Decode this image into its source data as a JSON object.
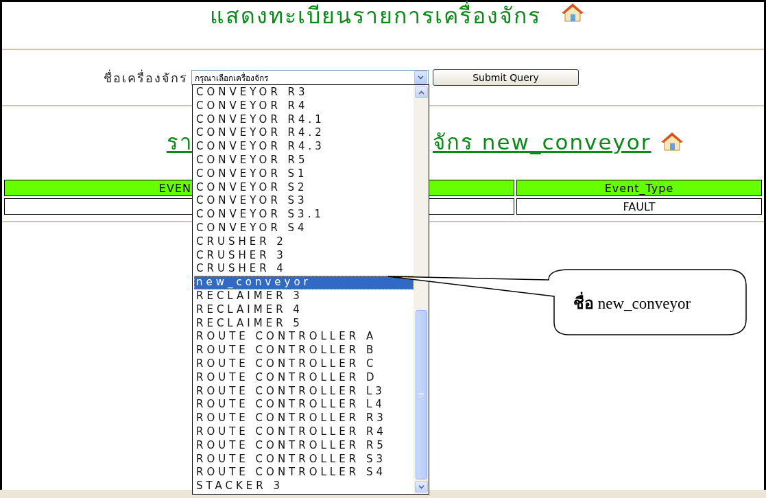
{
  "page_title": "แสดงทะเบียนรายการเครื่องจักร",
  "form": {
    "label": "ชื่อเครื่องจักร",
    "select": {
      "value": "กรุณาเลือกเครื่องจักร",
      "expanded": true
    },
    "submit": "Submit Query"
  },
  "dropdown": {
    "items": [
      {
        "label": "CONVEYOR R3",
        "selected": false
      },
      {
        "label": "CONVEYOR R4",
        "selected": false
      },
      {
        "label": "CONVEYOR R4.1",
        "selected": false
      },
      {
        "label": "CONVEYOR R4.2",
        "selected": false
      },
      {
        "label": "CONVEYOR R4.3",
        "selected": false
      },
      {
        "label": "CONVEYOR R5",
        "selected": false
      },
      {
        "label": "CONVEYOR S1",
        "selected": false
      },
      {
        "label": "CONVEYOR S2",
        "selected": false
      },
      {
        "label": "CONVEYOR S3",
        "selected": false
      },
      {
        "label": "CONVEYOR S3.1",
        "selected": false
      },
      {
        "label": "CONVEYOR S4",
        "selected": false
      },
      {
        "label": "CRUSHER 2",
        "selected": false
      },
      {
        "label": "CRUSHER 3",
        "selected": false
      },
      {
        "label": "CRUSHER 4",
        "selected": false
      },
      {
        "label": "new_conveyor",
        "selected": true
      },
      {
        "label": "RECLAIMER 3",
        "selected": false
      },
      {
        "label": "RECLAIMER 4",
        "selected": false
      },
      {
        "label": "RECLAIMER 5",
        "selected": false
      },
      {
        "label": "ROUTE CONTROLLER A",
        "selected": false
      },
      {
        "label": "ROUTE CONTROLLER B",
        "selected": false
      },
      {
        "label": "ROUTE CONTROLLER C",
        "selected": false
      },
      {
        "label": "ROUTE CONTROLLER D",
        "selected": false
      },
      {
        "label": "ROUTE CONTROLLER L3",
        "selected": false
      },
      {
        "label": "ROUTE CONTROLLER L4",
        "selected": false
      },
      {
        "label": "ROUTE CONTROLLER R3",
        "selected": false
      },
      {
        "label": "ROUTE CONTROLLER R4",
        "selected": false
      },
      {
        "label": "ROUTE CONTROLLER R5",
        "selected": false
      },
      {
        "label": "ROUTE CONTROLLER S3",
        "selected": false
      },
      {
        "label": "ROUTE CONTROLLER S4",
        "selected": false
      },
      {
        "label": "STACKER 3",
        "selected": false
      }
    ]
  },
  "result_heading": {
    "visible_start": "รา",
    "visible_end": "จักร new_conveyor"
  },
  "table": {
    "columns": [
      "EVEN",
      "Event_Type"
    ],
    "rows": [
      {
        "column_2": "FAULT"
      }
    ]
  },
  "callout": {
    "text": "**ชื่อ** new_conveyor"
  }
}
